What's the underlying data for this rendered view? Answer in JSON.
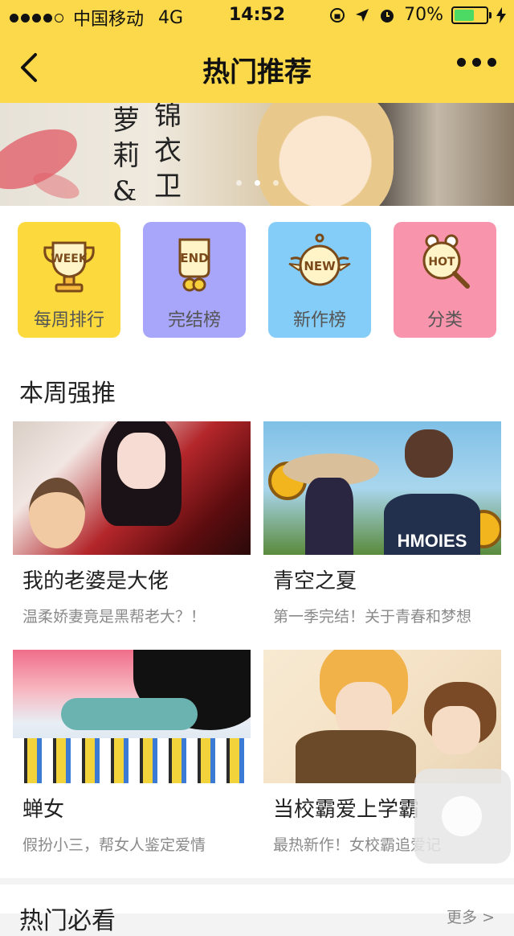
{
  "status_bar": {
    "carrier": "中国移动",
    "network": "4G",
    "time": "14:52",
    "battery": "70%",
    "battery_level": 0.7
  },
  "nav": {
    "title": "热门推荐",
    "back_icon": "chevron-left-icon",
    "more_icon": "more-dots-icon"
  },
  "banner": {
    "text_left": [
      "萝",
      "莉",
      "&"
    ],
    "text_right": [
      "锦",
      "衣",
      "卫"
    ],
    "pages": 3,
    "active_page": 2
  },
  "categories": [
    {
      "label": "每周排行",
      "badge": "WEEK",
      "color": "#fcd93d"
    },
    {
      "label": "完结榜",
      "badge": "END",
      "color": "#a8a6fb"
    },
    {
      "label": "新作榜",
      "badge": "NEW",
      "color": "#84cdf8"
    },
    {
      "label": "分类",
      "badge": "HOT",
      "color": "#f895ac"
    }
  ],
  "section": {
    "title": "本周强推",
    "items": [
      {
        "title": "我的老婆是大佬",
        "desc": "温柔娇妻竟是黑帮老大？！"
      },
      {
        "title": "青空之夏",
        "desc": "第一季完结！关于青春和梦想",
        "image_text": "HMOIES"
      },
      {
        "title": "蝉女",
        "desc": "假扮小三，帮女人鉴定爱情"
      },
      {
        "title": "当校霸爱上学霸",
        "desc": "最热新作！女校霸追爱记"
      }
    ]
  },
  "next_section": {
    "title": "热门必看",
    "more": "更多 >"
  },
  "colors": {
    "brand": "#fbd94a",
    "battery": "#4cd964"
  }
}
